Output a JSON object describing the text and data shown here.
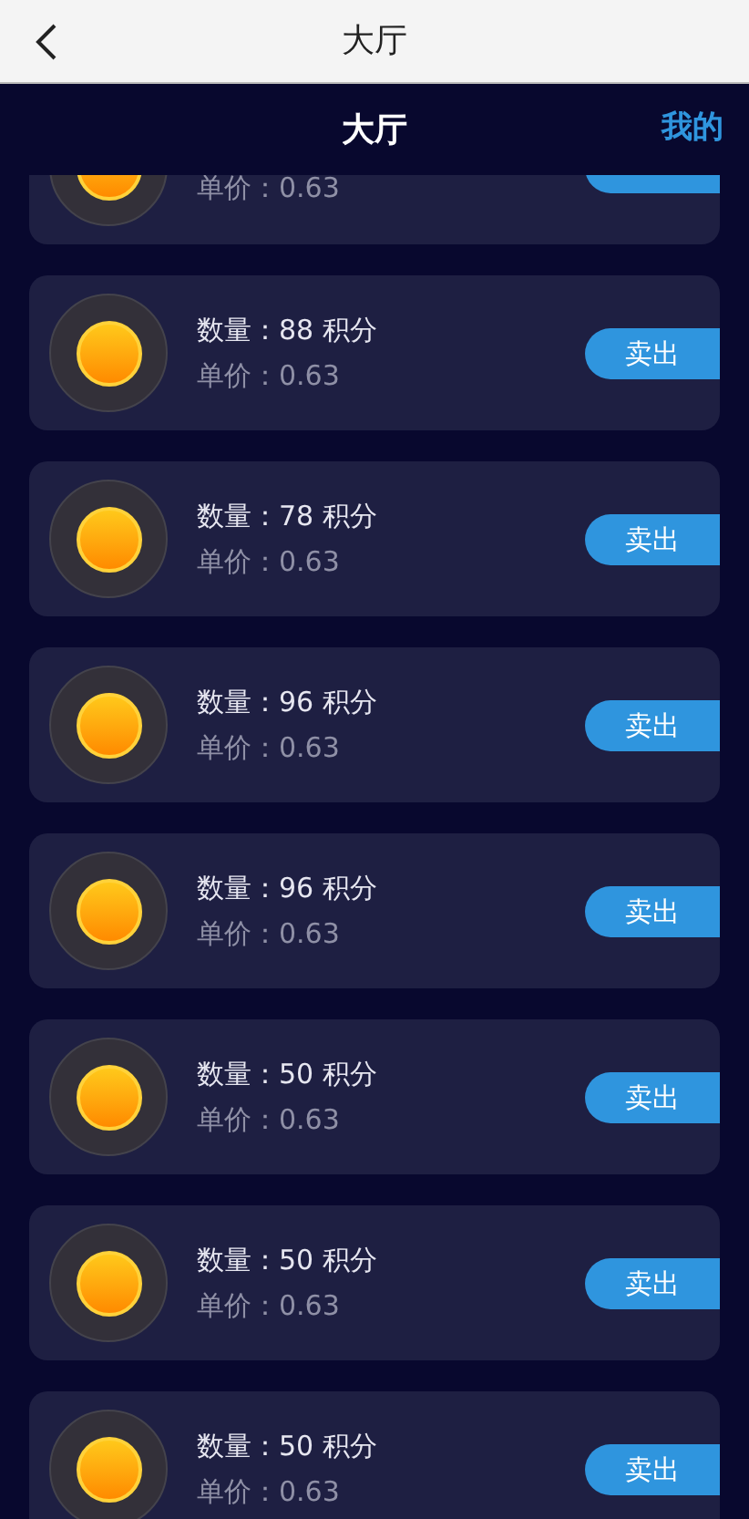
{
  "top_bar": {
    "title": "大厅"
  },
  "header": {
    "title": "大厅",
    "mine_link": "我的"
  },
  "orders": [
    {
      "price": "单价：0.63"
    },
    {
      "quantity": "数量：88 积分",
      "price": "单价：0.63",
      "button": "卖出"
    },
    {
      "quantity": "数量：78 积分",
      "price": "单价：0.63",
      "button": "卖出"
    },
    {
      "quantity": "数量：96 积分",
      "price": "单价：0.63",
      "button": "卖出"
    },
    {
      "quantity": "数量：96 积分",
      "price": "单价：0.63",
      "button": "卖出"
    },
    {
      "quantity": "数量：50 积分",
      "price": "单价：0.63",
      "button": "卖出"
    },
    {
      "quantity": "数量：50 积分",
      "price": "单价：0.63",
      "button": "卖出"
    },
    {
      "quantity": "数量：50 积分",
      "price": "单价：0.63",
      "button": "卖出"
    }
  ]
}
